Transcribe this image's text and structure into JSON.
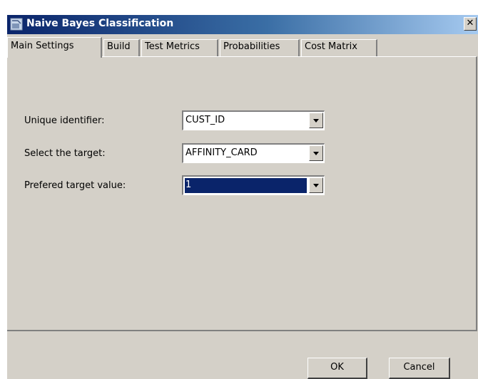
{
  "window": {
    "title": "Naive Bayes Classification",
    "close_glyph": "✕"
  },
  "tabs": [
    {
      "label": "Main Settings",
      "active": true
    },
    {
      "label": "Build",
      "active": false
    },
    {
      "label": "Test Metrics",
      "active": false
    },
    {
      "label": "Probabilities",
      "active": false
    },
    {
      "label": "Cost Matrix",
      "active": false
    }
  ],
  "form": {
    "unique_identifier": {
      "label": "Unique identifier:",
      "value": "CUST_ID"
    },
    "target": {
      "label": "Select the target:",
      "value": "AFFINITY_CARD"
    },
    "preferred_target_value": {
      "label": "Prefered target value:",
      "value": "1"
    }
  },
  "buttons": {
    "ok": "OK",
    "cancel": "Cancel"
  },
  "colors": {
    "selection": "#0a246a",
    "face": "#d4d0c8",
    "titlebar": "#0a246a"
  },
  "icons": {
    "app": "classification-app-icon",
    "dropdown": "chevron-down-icon"
  }
}
